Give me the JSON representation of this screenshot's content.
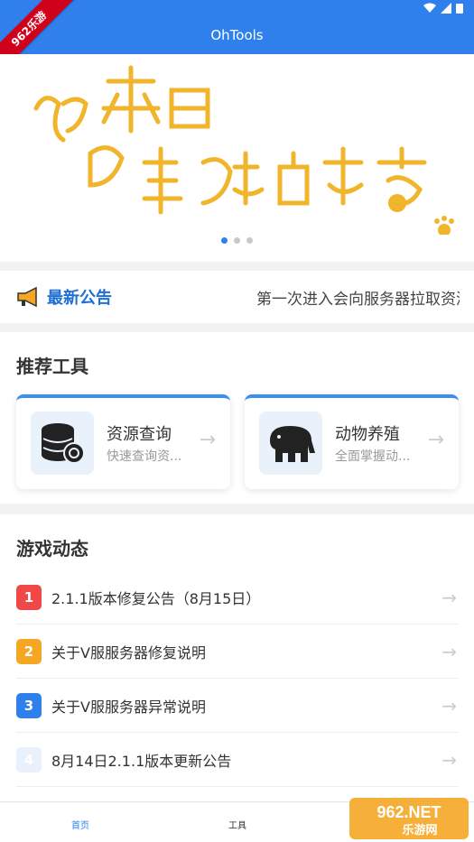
{
  "app": {
    "title": "OhTools",
    "ribbon": "962乐游"
  },
  "banner": {
    "slides": 3,
    "active_slide": 0,
    "art_text": "风来自很远的地方"
  },
  "notice": {
    "label": "最新公告",
    "text": "第一次进入会向服务器拉取资源"
  },
  "tools": {
    "title": "推荐工具",
    "items": [
      {
        "name": "资源查询",
        "desc": "快速查询资...",
        "icon": "database-search-icon"
      },
      {
        "name": "动物养殖",
        "desc": "全面掌握动...",
        "icon": "elephant-icon"
      }
    ]
  },
  "news": {
    "title": "游戏动态",
    "items": [
      {
        "num": "1",
        "color": "#f04848",
        "text": "2.1.1版本修复公告（8月15日）"
      },
      {
        "num": "2",
        "color": "#f5a623",
        "text": "关于V服服务器修复说明"
      },
      {
        "num": "3",
        "color": "#2f80ed",
        "text": "关于V服服务器异常说明"
      },
      {
        "num": "4",
        "color": "#e8f1fc",
        "text": "8月14日2.1.1版本更新公告"
      }
    ]
  },
  "nav": {
    "tabs": [
      {
        "label": "首页"
      },
      {
        "label": "工具"
      }
    ]
  },
  "watermark": {
    "brand": "962.NET",
    "sub": "乐游网"
  },
  "colors": {
    "primary": "#2f80ed",
    "banner_text": "#f0b52a"
  }
}
